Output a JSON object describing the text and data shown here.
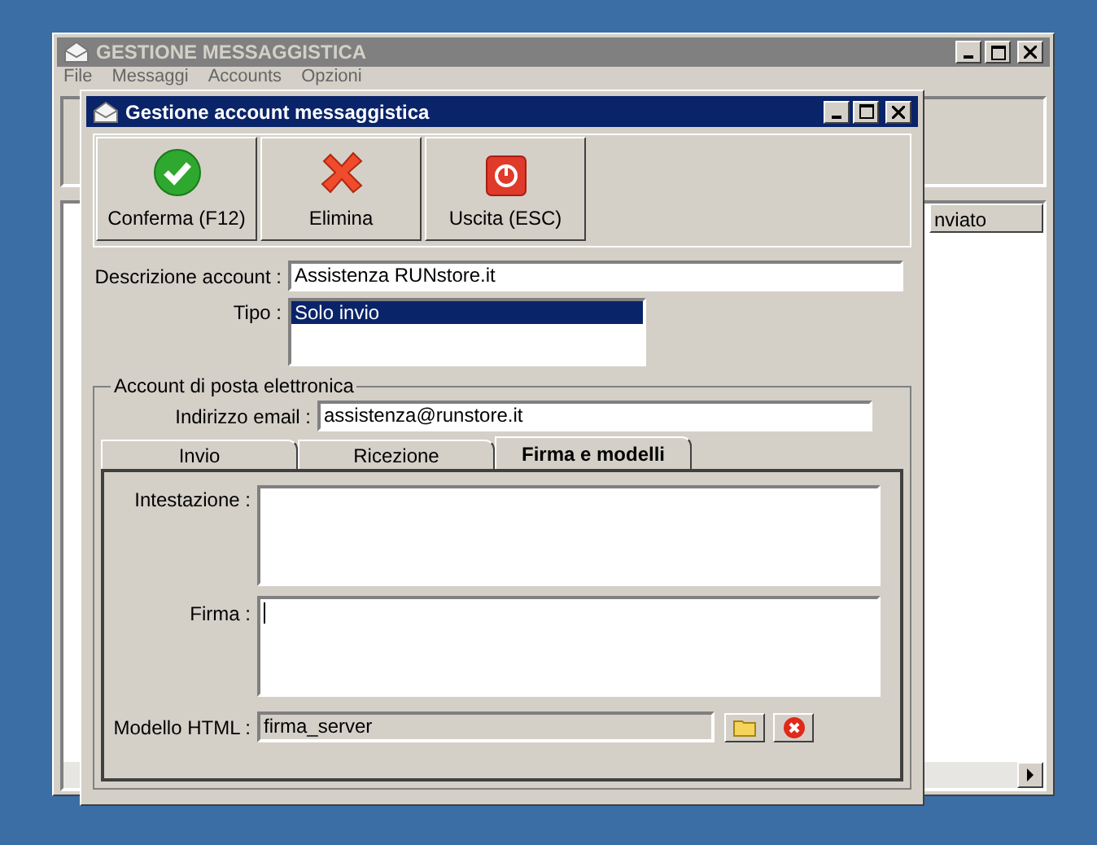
{
  "main_window": {
    "title": "GESTIONE MESSAGGISTICA",
    "menu": [
      "File",
      "Messaggi",
      "Accounts",
      "Opzioni"
    ],
    "list_column": "nviato"
  },
  "dialog": {
    "title": "Gestione account messaggistica",
    "toolbar": [
      {
        "kind": "confirm",
        "label": "Conferma (F12)"
      },
      {
        "kind": "delete",
        "label": "Elimina"
      },
      {
        "kind": "exit",
        "label": "Uscita (ESC)"
      }
    ],
    "description": {
      "label": "Descrizione account :",
      "value": "Assistenza RUNstore.it"
    },
    "type": {
      "label": "Tipo :",
      "options": [
        {
          "label": "Solo invio",
          "selected": true
        }
      ]
    },
    "group": {
      "legend": "Account di posta elettronica",
      "email": {
        "label": "Indirizzo email :",
        "value": "assistenza@runstore.it"
      },
      "tabs": [
        {
          "label": "Invio",
          "selected": false
        },
        {
          "label": "Ricezione",
          "selected": false
        },
        {
          "label": "Firma e modelli",
          "selected": true
        }
      ],
      "header": {
        "label": "Intestazione :"
      },
      "signature": {
        "label": "Firma :"
      },
      "template": {
        "label": "Modello HTML :",
        "value": "firma_server"
      }
    }
  }
}
